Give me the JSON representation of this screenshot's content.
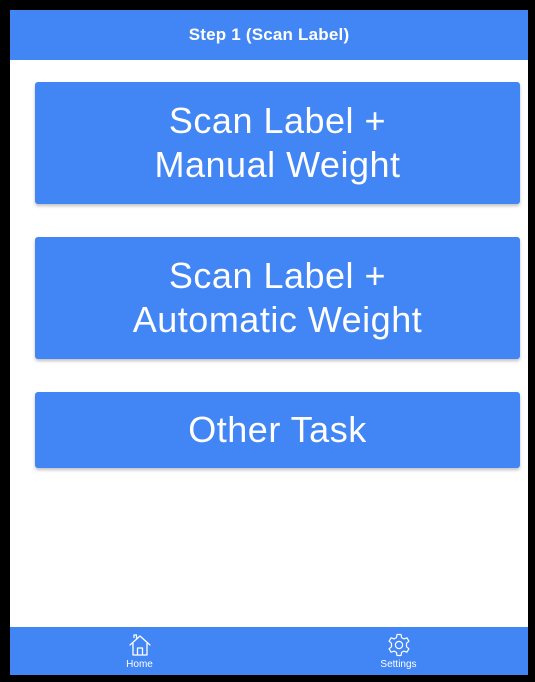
{
  "header": {
    "title": "Step 1 (Scan Label)"
  },
  "main": {
    "buttons": [
      {
        "line1": "Scan Label +",
        "line2": "Manual Weight"
      },
      {
        "line1": "Scan Label +",
        "line2": "Automatic Weight"
      },
      {
        "line1": "Other Task"
      }
    ]
  },
  "bottom_nav": {
    "items": [
      {
        "label": "Home",
        "icon": "home-icon"
      },
      {
        "label": "Settings",
        "icon": "gear-icon"
      }
    ]
  },
  "colors": {
    "primary": "#4285f4",
    "text_on_primary": "#ffffff",
    "frame": "#000000"
  }
}
